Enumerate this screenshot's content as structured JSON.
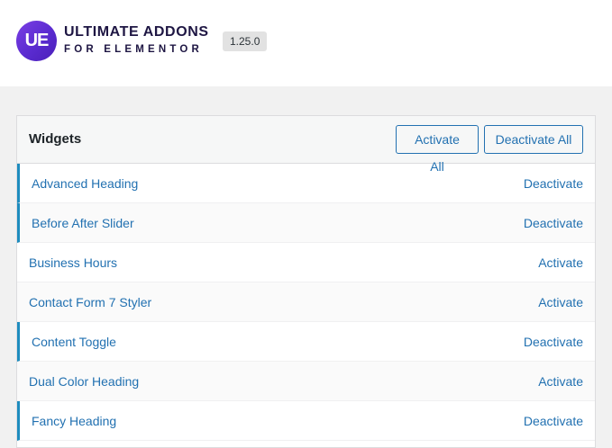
{
  "brand": {
    "logo_text": "UE",
    "name_line1": "ULTIMATE ADDONS",
    "name_line2": "FOR ELEMENTOR",
    "version": "1.25.0"
  },
  "panel": {
    "title": "Widgets",
    "activate_all_label": "Activate All",
    "deactivate_all_label": "Deactivate All"
  },
  "widgets": [
    {
      "name": "Advanced Heading",
      "action": "Deactivate",
      "active": true
    },
    {
      "name": "Before After Slider",
      "action": "Deactivate",
      "active": true
    },
    {
      "name": "Business Hours",
      "action": "Activate",
      "active": false
    },
    {
      "name": "Contact Form 7 Styler",
      "action": "Activate",
      "active": false
    },
    {
      "name": "Content Toggle",
      "action": "Deactivate",
      "active": true
    },
    {
      "name": "Dual Color Heading",
      "action": "Activate",
      "active": false
    },
    {
      "name": "Fancy Heading",
      "action": "Deactivate",
      "active": true
    }
  ],
  "colors": {
    "accent": "#2271b1",
    "active_marker": "#1e8cbe",
    "logo_purple": "#5a2bd0",
    "brand_text": "#1e1643"
  }
}
